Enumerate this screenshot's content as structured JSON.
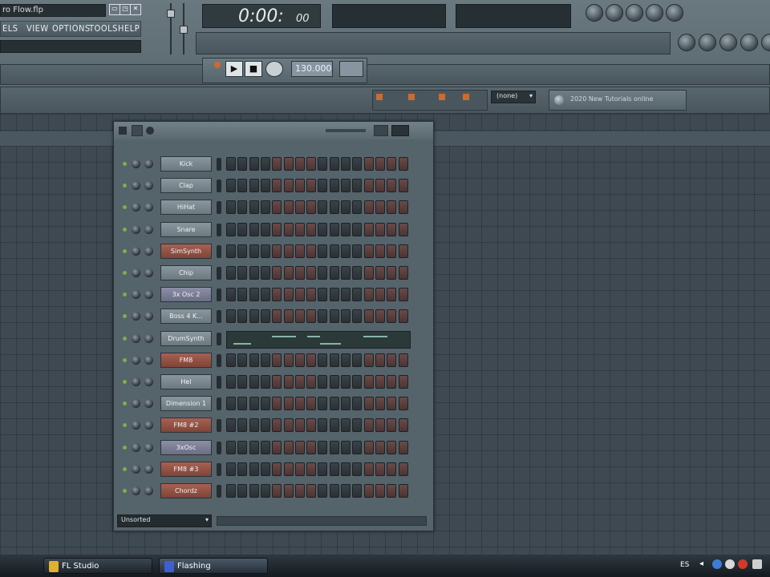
{
  "title": {
    "file": "ro Flow.flp"
  },
  "menu": [
    "ELS",
    "VIEW",
    "OPTIONS",
    "TOOLS",
    "HELP"
  ],
  "transport": {
    "time": "0:00:",
    "time_small": "00",
    "tempo": "130.000"
  },
  "pattern": {
    "selector": "(none)"
  },
  "hint": {
    "text": "2020 New Tutorials online"
  },
  "sequencer": {
    "filter": "Unsorted",
    "channels": [
      {
        "name": "Kick",
        "style": "gray"
      },
      {
        "name": "Clap",
        "style": "gray"
      },
      {
        "name": "HiHat",
        "style": "gray"
      },
      {
        "name": "Snare",
        "style": "gray"
      },
      {
        "name": "SimSynth",
        "style": "red"
      },
      {
        "name": "Chip",
        "style": "gray"
      },
      {
        "name": "3x Osc 2",
        "style": "lav"
      },
      {
        "name": "Boss 4 K...",
        "style": "gray"
      },
      {
        "name": "DrumSynth",
        "style": "gray",
        "graph": true
      },
      {
        "name": "FM8",
        "style": "red"
      },
      {
        "name": "Hel",
        "style": "gray"
      },
      {
        "name": "Dimension 1",
        "style": "gray"
      },
      {
        "name": "FM8 #2",
        "style": "red"
      },
      {
        "name": "3xOsc",
        "style": "lav"
      },
      {
        "name": "FM8 #3",
        "style": "red"
      },
      {
        "name": "Chordz",
        "style": "red"
      }
    ]
  },
  "taskbar": {
    "app1": "FL Studio",
    "app2": "Flashing",
    "lang": "ES"
  },
  "colors": {
    "accent_orange": "#d06a2a",
    "led_green": "#7fae4a",
    "step_red": "#6a4a48"
  }
}
